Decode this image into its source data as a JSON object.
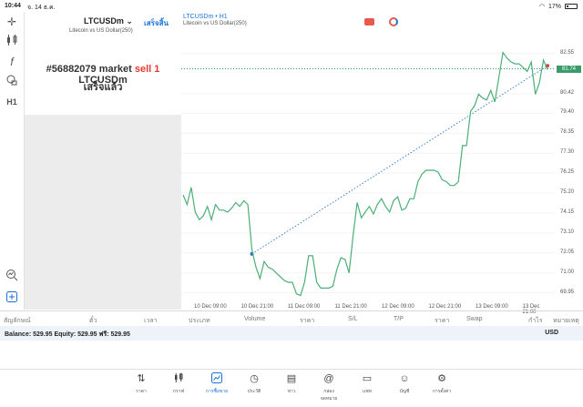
{
  "status_bar": {
    "time": "10:44",
    "date": "จ. 14 ธ.ค.",
    "battery": "17%"
  },
  "order_panel": {
    "symbol": "LTCUSDm",
    "description": "Litecoin vs US Dollar(250)",
    "done_button": "เสร็จสิ้น",
    "message_prefix": "#56882079 market",
    "message_side": "sell 1",
    "message_symbol": "LTCUSDm",
    "message_status": "เสร็จแล้ว"
  },
  "chart_header": {
    "symbol": "LTCUSDm",
    "timeframe": "H1",
    "description": "Litecoin vs US Dollar(250)"
  },
  "chart_data": {
    "type": "line",
    "symbol": "LTCUSDm",
    "timeframe": "H1",
    "y_ticks": [
      "82.55",
      "81.74",
      "80.42",
      "79.40",
      "78.35",
      "77.30",
      "76.25",
      "75.20",
      "74.15",
      "73.10",
      "72.05",
      "71.00",
      "69.95"
    ],
    "x_ticks": [
      "10 Dec 09:00",
      "10 Dec 21:00",
      "11 Dec 09:00",
      "11 Dec 21:00",
      "12 Dec 09:00",
      "12 Dec 21:00",
      "13 Dec 09:00",
      "13 Dec 21:00"
    ],
    "current_price": "81.74",
    "ylim": [
      69.5,
      83.3
    ],
    "series": [
      {
        "values": [
          75.1,
          74.6,
          75.5,
          74.2,
          73.8,
          74.0,
          74.5,
          73.8,
          74.6,
          74.3,
          74.3,
          74.2,
          74.4,
          74.7,
          74.5,
          74.8,
          74.6,
          72.2,
          71.3,
          70.7,
          71.6,
          71.3,
          71.2,
          71.0,
          70.8,
          70.6,
          70.5,
          70.5,
          69.9,
          69.8,
          70.5,
          71.9,
          71.9,
          70.5,
          70.2,
          70.2,
          70.2,
          70.3,
          71.2,
          71.8,
          71.7,
          71.0,
          73.0,
          74.7,
          73.9,
          74.2,
          74.5,
          74.1,
          74.6,
          74.9,
          74.5,
          74.2,
          74.8,
          75.0,
          74.3,
          74.4,
          74.9,
          74.9,
          75.8,
          76.2,
          76.4,
          76.4,
          76.4,
          76.3,
          75.9,
          75.8,
          75.6,
          75.6,
          75.8,
          77.7,
          77.7,
          79.5,
          79.8,
          80.4,
          80.2,
          80.1,
          80.6,
          80.0,
          81.3,
          82.6,
          82.3,
          82.1,
          82.0,
          82.0,
          81.8,
          81.6,
          82.1,
          80.4,
          81.0,
          82.2,
          81.7
        ]
      }
    ],
    "trade_line": {
      "from_price": 72.0,
      "to_price": 81.9
    }
  },
  "columns": [
    "สัญลักษณ์",
    "ตั๋ว",
    "เวลา",
    "ประเภท",
    "Volume",
    "ราคา",
    "S/L",
    "T/P",
    "ราคา",
    "Swap",
    "กำไร",
    "หมายเหตุ"
  ],
  "balance": {
    "text": "Balance: 529.95 Equity: 529.95 ฟรี: 529.95",
    "currency": "USD"
  },
  "nav": [
    {
      "icon": "quotes-icon",
      "label": "ราคา"
    },
    {
      "icon": "charts-icon",
      "label": "กราฟ"
    },
    {
      "icon": "trade-icon",
      "label": "การซื้อขาย"
    },
    {
      "icon": "history-icon",
      "label": "ประวัติ"
    },
    {
      "icon": "news-icon",
      "label": "ข่าว"
    },
    {
      "icon": "mailbox-icon",
      "label": "กล่องจดหมาย"
    },
    {
      "icon": "chat-icon",
      "label": "แชท"
    },
    {
      "icon": "account-icon",
      "label": "บัญชี"
    },
    {
      "icon": "settings-icon",
      "label": "การตั้งค่า"
    }
  ],
  "nav_active": "การซื้อขาย"
}
